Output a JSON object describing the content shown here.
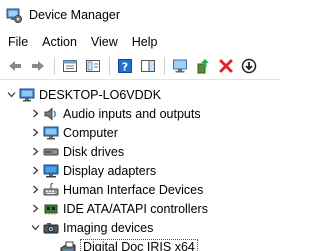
{
  "window": {
    "title": "Device Manager",
    "icon": "device-manager-icon"
  },
  "menu": [
    "File",
    "Action",
    "View",
    "Help"
  ],
  "toolbar": {
    "buttons": [
      "back-arrow-icon",
      "forward-arrow-icon",
      "properties-icon",
      "show-hidden-icon",
      "help-icon",
      "action-pane-icon",
      "scan-hardware-icon",
      "update-driver-icon",
      "uninstall-icon",
      "download-icon"
    ]
  },
  "tree": {
    "root": "DESKTOP-LO6VDDK",
    "categories": [
      {
        "label": "Audio inputs and outputs",
        "icon": "speaker-icon"
      },
      {
        "label": "Computer",
        "icon": "computer-icon"
      },
      {
        "label": "Disk drives",
        "icon": "disk-drive-icon"
      },
      {
        "label": "Display adapters",
        "icon": "display-adapter-icon"
      },
      {
        "label": "Human Interface Devices",
        "icon": "hid-icon"
      },
      {
        "label": "IDE ATA/ATAPI controllers",
        "icon": "ide-controller-icon"
      },
      {
        "label": "Imaging devices",
        "icon": "camera-icon"
      }
    ],
    "child": {
      "label": "Digital Doc IRIS x64",
      "icon": "scanner-icon"
    }
  },
  "colors": {
    "accent": "#1e6fd0",
    "delete": "#e0242a",
    "text": "#000000"
  }
}
